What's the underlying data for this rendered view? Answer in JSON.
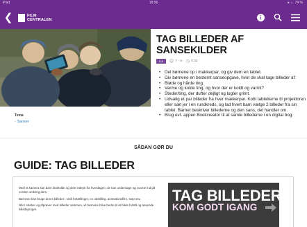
{
  "status_bar": {
    "left": "iPad",
    "time": "18:56",
    "right": "▸ ∟ 74 %"
  },
  "app_bar": {
    "logo_text": "FILM CENTRALEN",
    "icons": [
      "back-icon",
      "info-icon",
      "search-icon",
      "menu-icon"
    ],
    "accent_color": "#6b2b8f"
  },
  "sidebar": {
    "tema_label": "Tema",
    "tema_link": "- Sanser"
  },
  "article": {
    "title": "TAG BILLEDER AF SANSEKILDER",
    "badge": "0-6",
    "age": "7 - 9",
    "duration": "0:33",
    "bullets": [
      "Del børnene op i makkerpar, og giv dem en tablet.",
      "Giv børnene en bestemt sanseopgave, hvor de skal tage billeder af:",
      "Bløde og hårde ting.",
      "Varme og kolde ting, og hvor der er koldt og varmt?",
      "Steder/ting, der dufter dejligt og lugter grimt.",
      "Udvælg et par billeder fra hver makkerpar. Kobl tabletterne til projektoren eller sæt jer i en rundkreds, og lad hvert barn vælge 2 billeder fra sin tablet. Barnet beskriver billederne og den sans, det handler om.",
      "Brug evt. appen Bookcreator til at samle billederne i en digital bog."
    ]
  },
  "how_to": {
    "section_title": "SÅDAN GØR DU",
    "guide_title": "GUIDE: TAG BILLEDER"
  },
  "guide": {
    "paragraphs": [
      "Med et kamera kan barn fastholde og dele indtryk fra hverdagen, de kan undersøge og zoome ind på verden omkring dem.",
      "Børnene kan bruge deres billeder i små fortællinger, en udstilling, animationsfilm, stop osv.",
      "Når I skaber og afprøver med billeder sammen, vil børnene blive bedre til at både forstå og anvende billedsproget."
    ],
    "video_title": "TAG BILLEDER",
    "video_subtitle": "KOM GODT IGANG"
  }
}
